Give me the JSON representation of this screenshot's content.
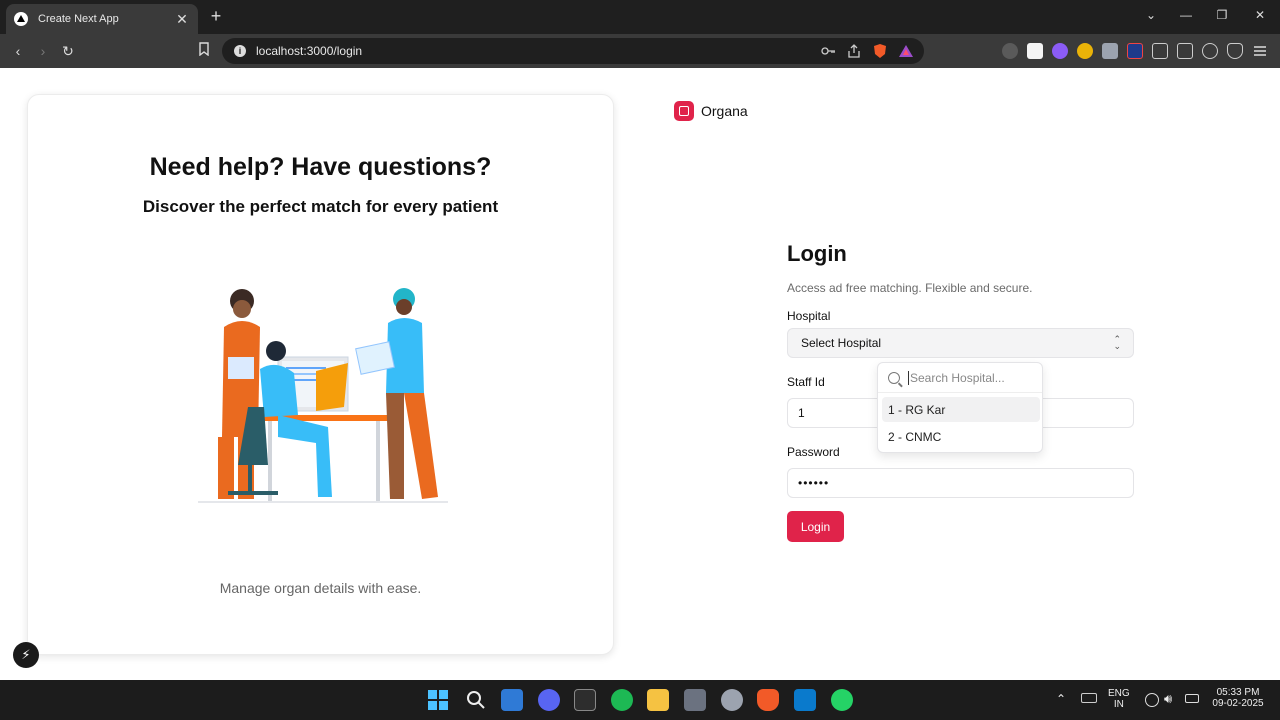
{
  "browser": {
    "tab_title": "Create Next App",
    "tab_close": "✕",
    "new_tab": "+",
    "url": "localhost:3000/login",
    "win_controls": {
      "dropdown": "⌄",
      "minimize": "—",
      "restore": "❐",
      "close": "✕"
    },
    "nav": {
      "back": "‹",
      "forward": "›",
      "reload": "↻"
    }
  },
  "left_panel": {
    "title": "Need help? Have questions?",
    "subtitle": "Discover the perfect match for every patient",
    "caption": "Manage organ details with ease."
  },
  "brand": {
    "name": "Organa",
    "color": "#e0234a"
  },
  "login": {
    "title": "Login",
    "description": "Access ad free matching. Flexible and secure.",
    "hospital_label": "Hospital",
    "hospital_select_value": "Select Hospital",
    "staff_id_label": "Staff Id",
    "staff_id_value": "1",
    "password_label": "Password",
    "password_value": "••••••",
    "submit_label": "Login"
  },
  "dropdown": {
    "search_placeholder": "Search Hospital...",
    "options": [
      "1 - RG Kar",
      "2 - CNMC"
    ]
  },
  "dev_badge_icon": "⚡",
  "taskbar": {
    "language": "ENG",
    "region": "IN",
    "time": "05:33 PM",
    "date": "09-02-2025"
  },
  "colors": {
    "accent": "#e0234a",
    "chrome_dark": "#1f1f1f",
    "chrome_mid": "#3a3a3a"
  }
}
